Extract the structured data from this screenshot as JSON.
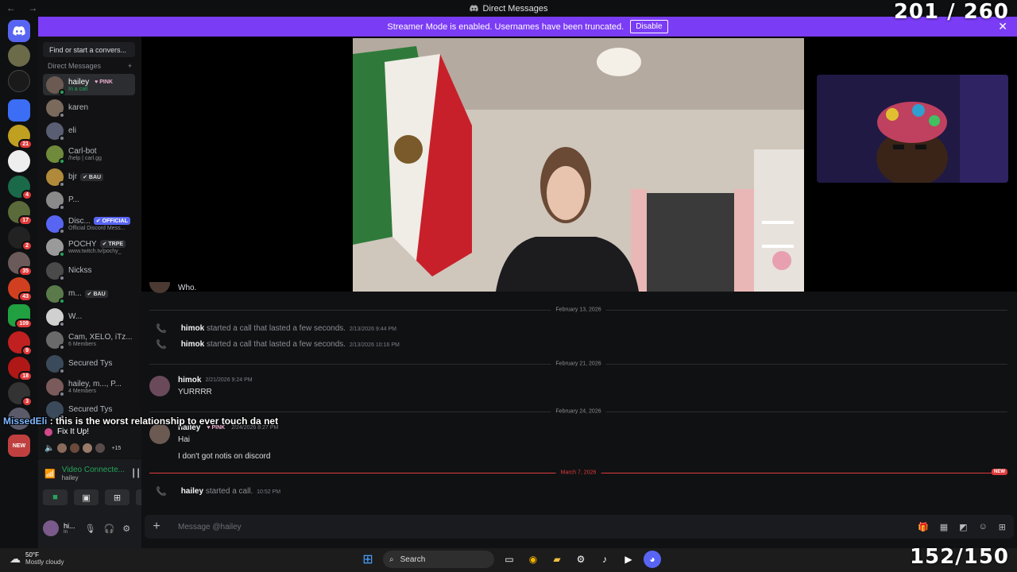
{
  "window": {
    "title": "Direct Messages",
    "nav": "← →"
  },
  "overlays": {
    "top_counter": "201 / 260",
    "bottom_counter": "152/150"
  },
  "banner": {
    "text": "Streamer Mode is enabled. Usernames have been truncated.",
    "disable_label": "Disable",
    "close": "✕"
  },
  "rail": {
    "badges": [
      "21",
      "4",
      "17",
      "2",
      "35",
      "43",
      "109",
      "9",
      "18",
      "3",
      "NEW"
    ]
  },
  "sidebar": {
    "search_placeholder": "Find or start a convers...",
    "header": "Direct Messages",
    "add": "+",
    "dms": [
      {
        "name": "hailey",
        "tag": "♥ PINK",
        "sub": "In a call",
        "color": "#6b5a52"
      },
      {
        "name": "karen",
        "tag": "",
        "sub": "",
        "color": "#7a6a5c"
      },
      {
        "name": "eli",
        "tag": "",
        "sub": "",
        "color": "#5a5e72"
      },
      {
        "name": "Carl-bot",
        "tag": "",
        "sub": "/help | carl.gg",
        "color": "#6f8a3a"
      },
      {
        "name": "bjr",
        "tag": "✔ BAU",
        "sub": "",
        "color": "#b08a3a"
      },
      {
        "name": "P...",
        "tag": "",
        "sub": "",
        "color": "#8a8a8a"
      },
      {
        "name": "Disc...",
        "tag": "✔ OFFICIAL",
        "sub": "Official Discord Mess...",
        "color": "#5865f2"
      },
      {
        "name": "POCHY",
        "tag": "✔ TRPE",
        "sub": "www.twitch.tv/pochy_",
        "color": "#9a9a9a"
      },
      {
        "name": "Nickss",
        "tag": "",
        "sub": "",
        "color": "#4a4a4a"
      },
      {
        "name": "m...",
        "tag": "✔ BAU",
        "sub": "",
        "color": "#5a7a4a"
      },
      {
        "name": "W...",
        "tag": "",
        "sub": "",
        "color": "#d0d0d0"
      },
      {
        "name": "Cam, XELO, iTz...",
        "tag": "",
        "sub": "6 Members",
        "color": "#6a6a6a"
      },
      {
        "name": "Secured Tys",
        "tag": "",
        "sub": "",
        "color": "#3a4a5a"
      },
      {
        "name": "hailey, m..., P...",
        "tag": "",
        "sub": "4 Members",
        "color": "#7a5a5a"
      },
      {
        "name": "Secured Tys",
        "tag": "",
        "sub": "",
        "color": "#3a4a5a"
      }
    ]
  },
  "activity": {
    "title": "Fix It Up!",
    "more": "+15"
  },
  "voice": {
    "status": "Video Connecte...",
    "channel": "hailey"
  },
  "user": {
    "name": "hi...",
    "status": "In"
  },
  "caption": {
    "who": "MissedEli",
    "text": " : this is the worst relationship to ever touch da net"
  },
  "messages": {
    "partial": "Who.",
    "dividers": [
      "February 13, 2026",
      "February 21, 2026",
      "February 24, 2026",
      "March 7, 2026"
    ],
    "new_tag": "NEW",
    "calls": [
      {
        "author": "himok",
        "text": "started a call that lasted a few seconds.",
        "ts": "2/13/2026 9:44 PM"
      },
      {
        "author": "himok",
        "text": "started a call that lasted a few seconds.",
        "ts": "2/13/2026 10:16 PM"
      },
      {
        "author": "hailey",
        "text": "started a call.",
        "ts": "10:52 PM"
      }
    ],
    "posts": [
      {
        "author": "himok",
        "tag": "",
        "ts": "2/21/2026 9:24 PM",
        "lines": [
          "YURRRR"
        ]
      },
      {
        "author": "hailey",
        "tag": "♥ PINK",
        "ts": "2/24/2026 8:27 PM",
        "lines": [
          "Hai",
          "I don't got notis on discord"
        ]
      }
    ]
  },
  "composer": {
    "placeholder": "Message @hailey"
  },
  "taskbar": {
    "temp": "50°F",
    "weather": "Mostly cloudy",
    "search": "Search"
  },
  "colors": {
    "accent": "#7b3cf5",
    "online": "#23a55a",
    "danger": "#e03b3b",
    "brand": "#5865f2"
  }
}
